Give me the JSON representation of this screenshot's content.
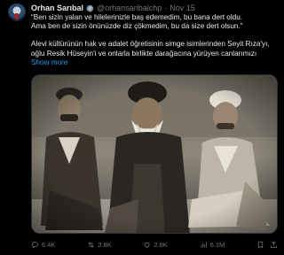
{
  "tweet": {
    "author_name": "Orhan Sarıbal",
    "handle": "@orhansaribalchp",
    "separator": "·",
    "date": "Nov 15",
    "lines": [
      "“Ben sizin yalan ve hilelerinizle baş edemedim, bu bana dert oldu.",
      "Ama ben de sizin önünüzde diz çökmedim, bu da size dert olsun.”"
    ],
    "lines2": [
      "Alevi kültürünün hak ve adalet öğretisinin simge isimlerinden Seyit Rıza'yı,",
      "oğlu Resik Hüseyin'i ve onlarla birlikte darağacına yürüyen canlarımızı"
    ],
    "show_more": "Show more"
  },
  "photo": {
    "description_icon": "historical-photo"
  },
  "actions": {
    "replies": "6.4K",
    "reposts": "2.8K",
    "likes": "2.8K",
    "views": "6.1M"
  },
  "colors": {
    "accent": "#1d9bf0",
    "muted": "#71767b",
    "text": "#e7e9ea",
    "background": "#000000"
  }
}
